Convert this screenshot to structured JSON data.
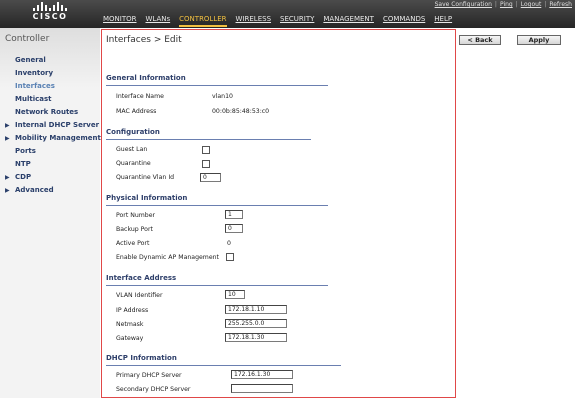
{
  "header": {
    "brand": "CISCO",
    "top_links": [
      "Save Configuration",
      "Ping",
      "Logout",
      "Refresh"
    ],
    "menu": [
      "MONITOR",
      "WLANs",
      "CONTROLLER",
      "WIRELESS",
      "SECURITY",
      "MANAGEMENT",
      "COMMANDS",
      "HELP"
    ],
    "active_menu": "CONTROLLER"
  },
  "sidebar": {
    "title": "Controller",
    "items": [
      {
        "label": "General",
        "expandable": false
      },
      {
        "label": "Inventory",
        "expandable": false
      },
      {
        "label": "Interfaces",
        "expandable": false,
        "active": true
      },
      {
        "label": "Multicast",
        "expandable": false
      },
      {
        "label": "Network Routes",
        "expandable": false
      },
      {
        "label": "Internal DHCP Server",
        "expandable": true
      },
      {
        "label": "Mobility Management",
        "expandable": true
      },
      {
        "label": "Ports",
        "expandable": false
      },
      {
        "label": "NTP",
        "expandable": false
      },
      {
        "label": "CDP",
        "expandable": true
      },
      {
        "label": "Advanced",
        "expandable": true
      }
    ]
  },
  "page": {
    "title": "Interfaces > Edit",
    "back_label": "< Back",
    "apply_label": "Apply"
  },
  "general": {
    "heading": "General Information",
    "interface_name_label": "Interface Name",
    "interface_name": "vlan10",
    "mac_label": "MAC Address",
    "mac": "00:0b:85:48:53:c0"
  },
  "configuration": {
    "heading": "Configuration",
    "guest_lan_label": "Guest Lan",
    "quarantine_label": "Quarantine",
    "quarantine_vlan_label": "Quarantine Vlan Id",
    "quarantine_vlan_value": "0"
  },
  "physical": {
    "heading": "Physical Information",
    "port_number_label": "Port Number",
    "port_number": "1",
    "backup_port_label": "Backup Port",
    "backup_port": "0",
    "active_port_label": "Active Port",
    "active_port": "0",
    "dyn_ap_label": "Enable Dynamic AP Management"
  },
  "address": {
    "heading": "Interface Address",
    "vlan_id_label": "VLAN Identifier",
    "vlan_id": "10",
    "ip_label": "IP Address",
    "ip": "172.18.1.10",
    "netmask_label": "Netmask",
    "netmask": "255.255.0.0",
    "gateway_label": "Gateway",
    "gateway": "172.18.1.30"
  },
  "dhcp": {
    "heading": "DHCP Information",
    "primary_label": "Primary DHCP Server",
    "primary": "172.16.1.30",
    "secondary_label": "Secondary DHCP Server",
    "secondary": ""
  }
}
